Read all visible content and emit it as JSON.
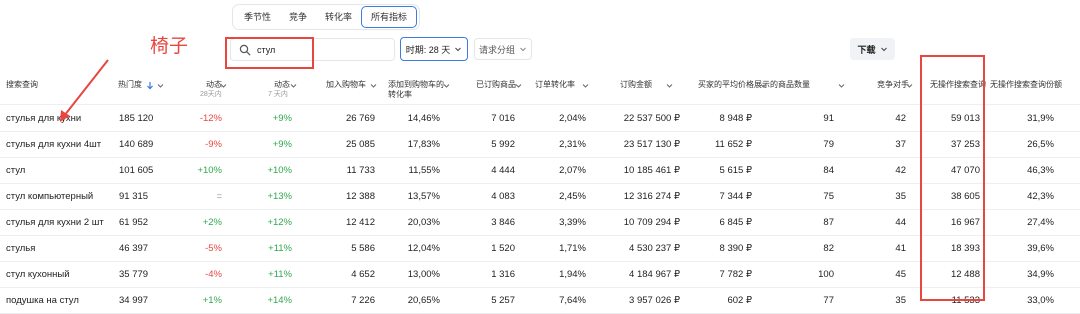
{
  "tabs": [
    {
      "label": "季节性",
      "active": false
    },
    {
      "label": "竞争",
      "active": false
    },
    {
      "label": "转化率",
      "active": false
    },
    {
      "label": "所有指标",
      "active": true
    }
  ],
  "annotation": {
    "label": "椅子"
  },
  "search": {
    "value": "стул"
  },
  "period": {
    "label": "时期: 28 天"
  },
  "grouping": {
    "label": "请求分组"
  },
  "download": {
    "label": "下载"
  },
  "columns": [
    {
      "label": "搜索查询"
    },
    {
      "label": "热门度"
    },
    {
      "label": "动态",
      "sub": "28天内"
    },
    {
      "label": "动态",
      "sub": "7 天内"
    },
    {
      "label": "加入购物车"
    },
    {
      "label": "添加到购物车的转化率"
    },
    {
      "label": "已订购商品"
    },
    {
      "label": "订单转化率"
    },
    {
      "label": "订购金额"
    },
    {
      "label": "买家的平均价格"
    },
    {
      "label": "展示的商品数量"
    },
    {
      "label": "竞争对手"
    },
    {
      "label": "无操作搜索查询"
    },
    {
      "label": "无操作搜索查询份额"
    }
  ],
  "rows": [
    {
      "query": "стулья для кухни",
      "popularity": "185 120",
      "dyn28": "-12%",
      "dyn28_color": "red",
      "dyn7": "+9%",
      "dyn7_color": "green",
      "cart": "26 769",
      "cart_conv": "14,46%",
      "ordered": "7 016",
      "order_conv": "2,04%",
      "order_sum": "22 537 500 ₽",
      "avg_price": "8 948 ₽",
      "shown": "91",
      "competitors": "42",
      "no_action": "59 013",
      "no_action_share": "31,9%"
    },
    {
      "query": "стулья для кухни 4шт",
      "popularity": "140 689",
      "dyn28": "-9%",
      "dyn28_color": "red",
      "dyn7": "+9%",
      "dyn7_color": "green",
      "cart": "25 085",
      "cart_conv": "17,83%",
      "ordered": "5 992",
      "order_conv": "2,31%",
      "order_sum": "23 517 130 ₽",
      "avg_price": "11 652 ₽",
      "shown": "79",
      "competitors": "37",
      "no_action": "37 253",
      "no_action_share": "26,5%"
    },
    {
      "query": "стул",
      "popularity": "101 605",
      "dyn28": "+10%",
      "dyn28_color": "green",
      "dyn7": "+10%",
      "dyn7_color": "green",
      "cart": "11 733",
      "cart_conv": "11,55%",
      "ordered": "4 444",
      "order_conv": "2,07%",
      "order_sum": "10 185 461 ₽",
      "avg_price": "5 615 ₽",
      "shown": "84",
      "competitors": "42",
      "no_action": "47 070",
      "no_action_share": "46,3%"
    },
    {
      "query": "стул компьютерный",
      "popularity": "91 315",
      "dyn28": "=",
      "dyn28_color": "gray",
      "dyn7": "+13%",
      "dyn7_color": "green",
      "cart": "12 388",
      "cart_conv": "13,57%",
      "ordered": "4 083",
      "order_conv": "2,45%",
      "order_sum": "12 316 274 ₽",
      "avg_price": "7 344 ₽",
      "shown": "75",
      "competitors": "35",
      "no_action": "38 605",
      "no_action_share": "42,3%"
    },
    {
      "query": "стулья для кухни 2 шт",
      "popularity": "61 952",
      "dyn28": "+2%",
      "dyn28_color": "green",
      "dyn7": "+12%",
      "dyn7_color": "green",
      "cart": "12 412",
      "cart_conv": "20,03%",
      "ordered": "3 846",
      "order_conv": "3,39%",
      "order_sum": "10 709 294 ₽",
      "avg_price": "6 845 ₽",
      "shown": "87",
      "competitors": "44",
      "no_action": "16 967",
      "no_action_share": "27,4%"
    },
    {
      "query": "стулья",
      "popularity": "46 397",
      "dyn28": "-5%",
      "dyn28_color": "red",
      "dyn7": "+11%",
      "dyn7_color": "green",
      "cart": "5 586",
      "cart_conv": "12,04%",
      "ordered": "1 520",
      "order_conv": "1,71%",
      "order_sum": "4 530 237 ₽",
      "avg_price": "8 390 ₽",
      "shown": "82",
      "competitors": "41",
      "no_action": "18 393",
      "no_action_share": "39,6%"
    },
    {
      "query": "стул кухонный",
      "popularity": "35 779",
      "dyn28": "-4%",
      "dyn28_color": "red",
      "dyn7": "+11%",
      "dyn7_color": "green",
      "cart": "4 652",
      "cart_conv": "13,00%",
      "ordered": "1 316",
      "order_conv": "1,94%",
      "order_sum": "4 184 967 ₽",
      "avg_price": "7 782 ₽",
      "shown": "100",
      "competitors": "45",
      "no_action": "12 488",
      "no_action_share": "34,9%"
    },
    {
      "query": "подушка на стул",
      "popularity": "34 997",
      "dyn28": "+1%",
      "dyn28_color": "green",
      "dyn7": "+14%",
      "dyn7_color": "green",
      "cart": "7 226",
      "cart_conv": "20,65%",
      "ordered": "5 257",
      "order_conv": "7,64%",
      "order_sum": "3 957 026 ₽",
      "avg_price": "602 ₽",
      "shown": "77",
      "competitors": "35",
      "no_action": "11 533",
      "no_action_share": "33,0%"
    }
  ],
  "colors": {
    "accent": "#3d7be0",
    "annotation": "#e8463f",
    "positive": "#2fa84f",
    "negative": "#e8463f"
  }
}
